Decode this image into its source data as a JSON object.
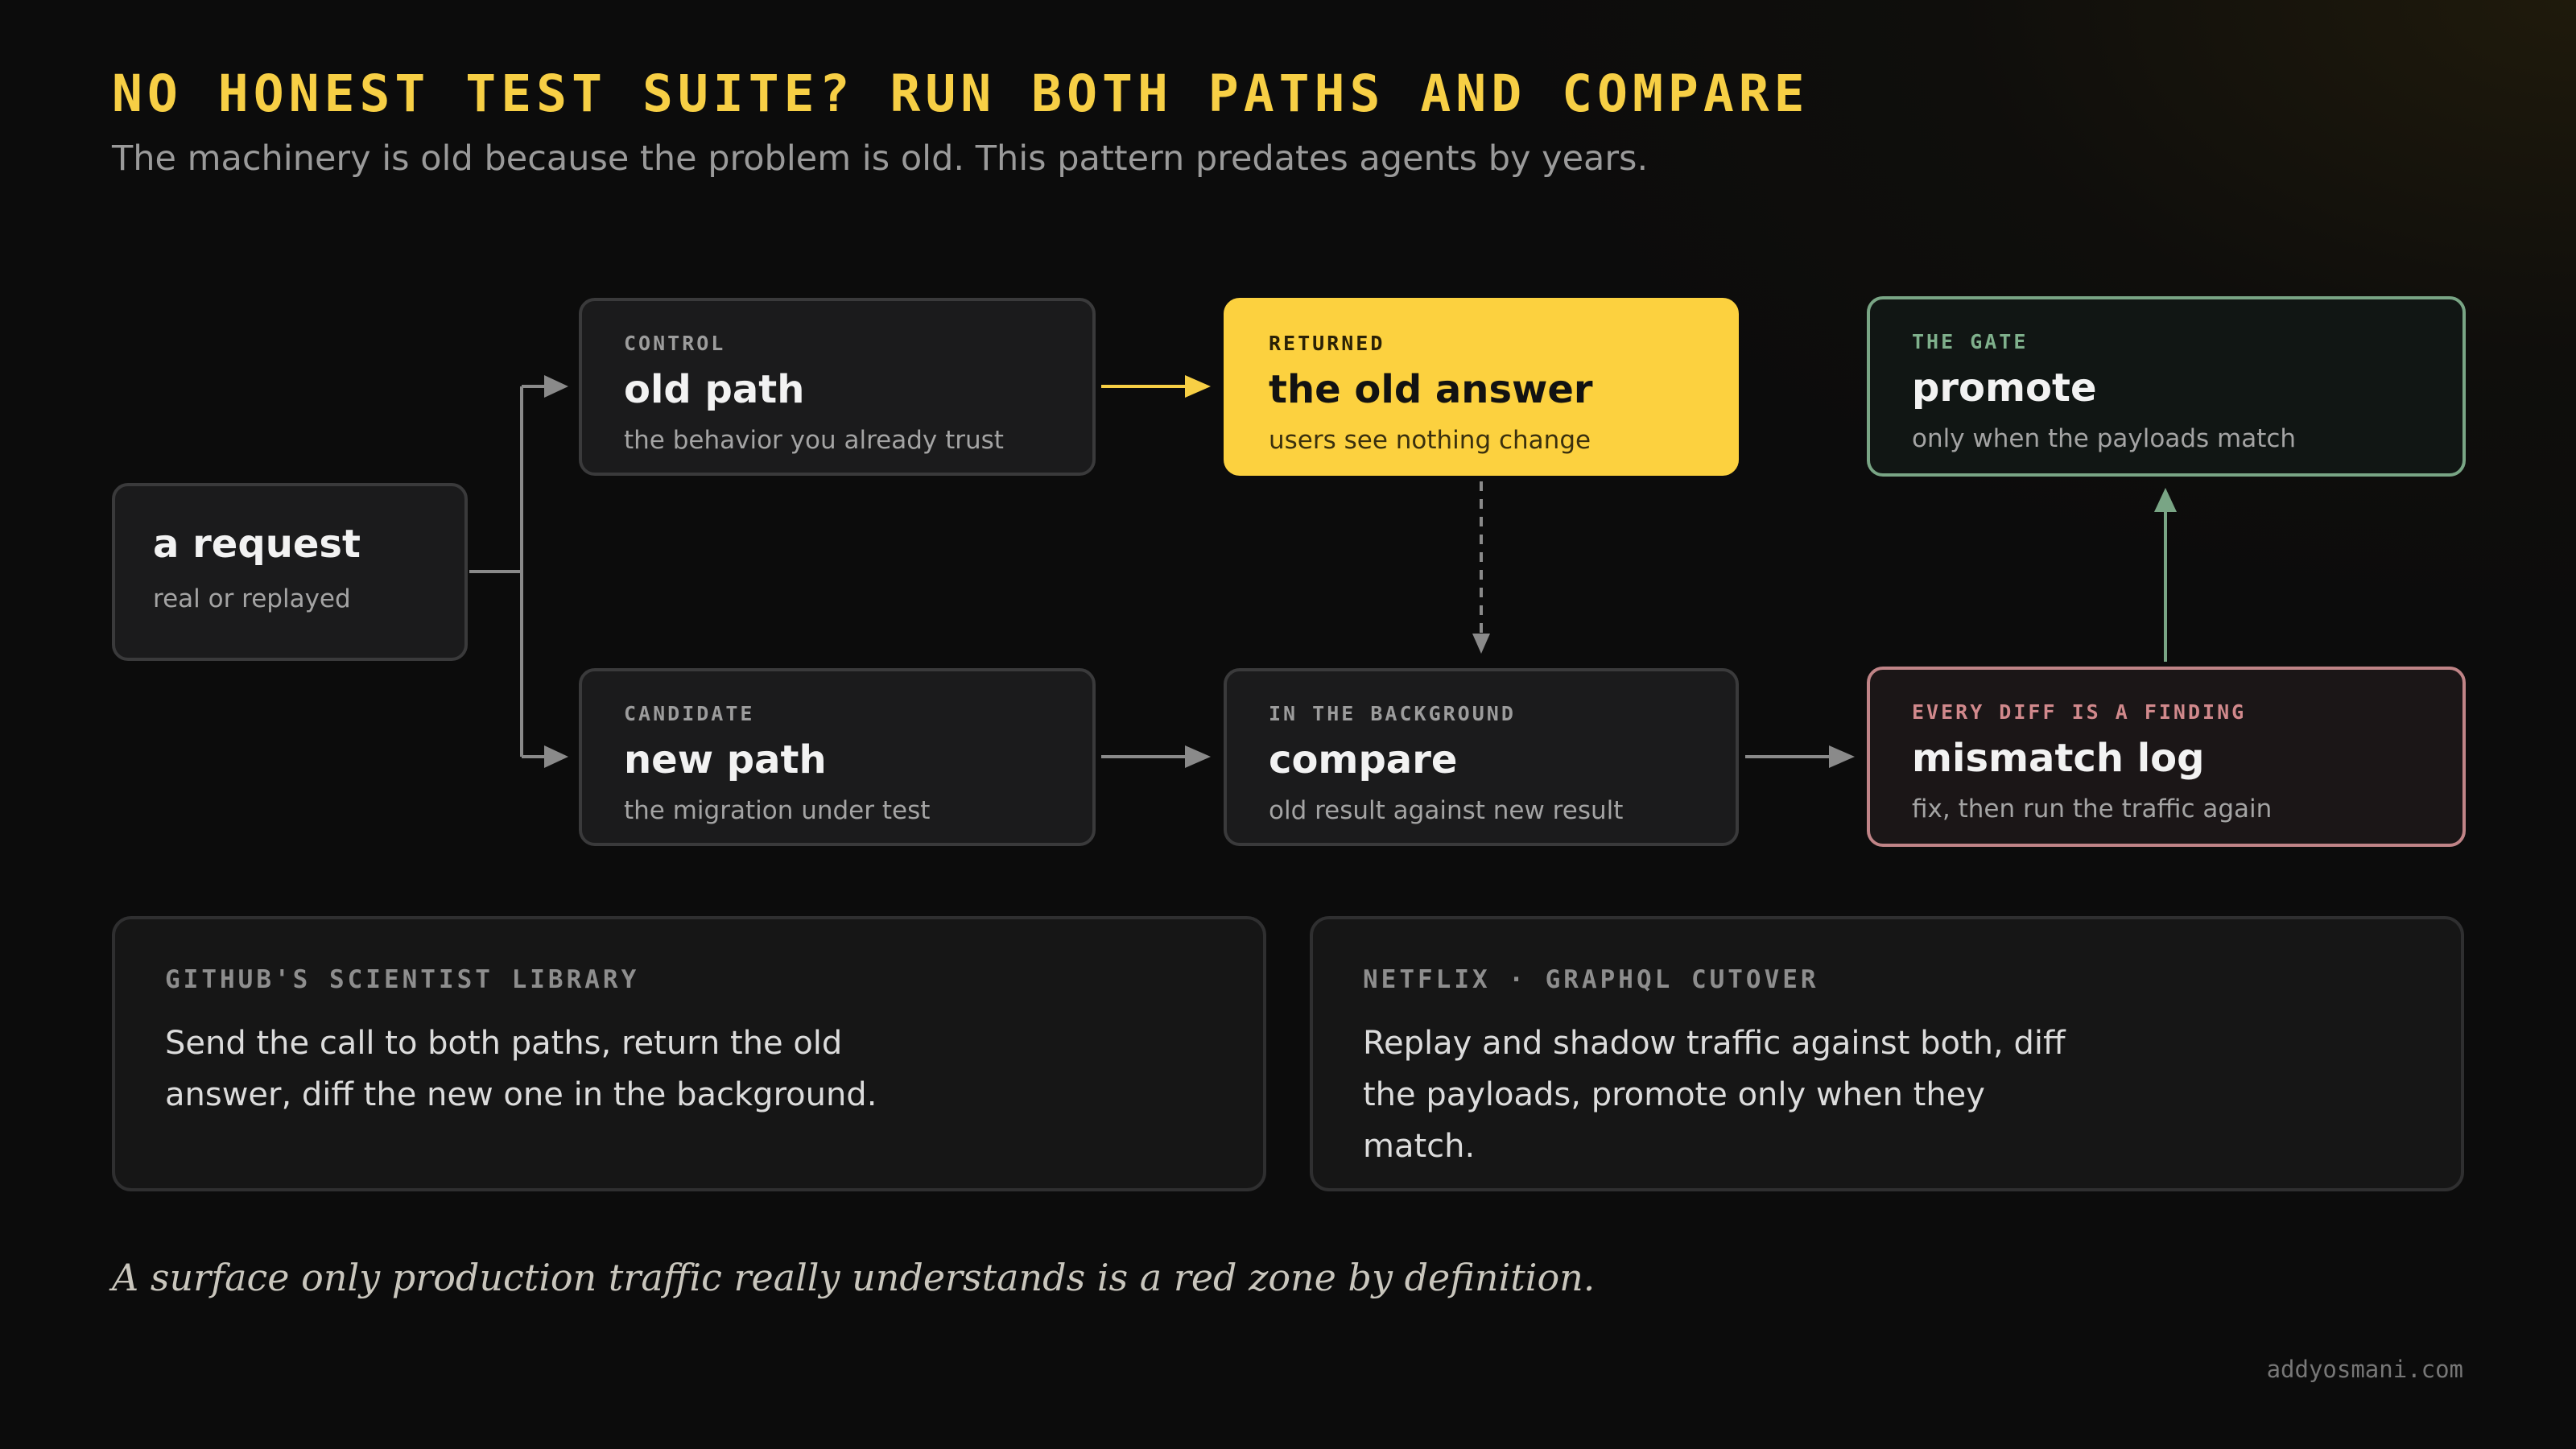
{
  "header": {
    "title": "NO HONEST TEST SUITE? RUN BOTH PATHS AND COMPARE",
    "subtitle": "The machinery is old because the problem is old. This pattern predates agents by years."
  },
  "diagram": {
    "request": {
      "name": "a request",
      "description": "real or replayed"
    },
    "control": {
      "kicker": "CONTROL",
      "name": "old path",
      "description": "the behavior you already trust"
    },
    "candidate": {
      "kicker": "CANDIDATE",
      "name": "new path",
      "description": "the migration under test"
    },
    "returned": {
      "kicker": "RETURNED",
      "name": "the old answer",
      "description": "users see nothing change"
    },
    "compare": {
      "kicker": "IN THE BACKGROUND",
      "name": "compare",
      "description": "old result against new result"
    },
    "gate": {
      "kicker": "THE GATE",
      "name": "promote",
      "description": "only when the payloads match"
    },
    "mismatch": {
      "kicker": "EVERY DIFF IS A FINDING",
      "name": "mismatch log",
      "description": "fix, then run the traffic again"
    }
  },
  "cards": {
    "github": {
      "kicker": "GITHUB'S SCIENTIST LIBRARY",
      "body": "Send the call to both paths, return the old answer, diff the new one in the background."
    },
    "netflix": {
      "kicker": "NETFLIX · GRAPHQL CUTOVER",
      "body": "Replay and shadow traffic against both, diff the payloads, promote only when they match."
    }
  },
  "footer": {
    "quote": "A surface only production traffic really understands is a red zone by definition.",
    "credit": "addyosmani.com"
  },
  "colors": {
    "accent": "#f7cf45",
    "returned_fill": "#fcd13f",
    "gate": "#79a585",
    "mismatch": "#c08487",
    "connector": "#8a8a8a"
  }
}
